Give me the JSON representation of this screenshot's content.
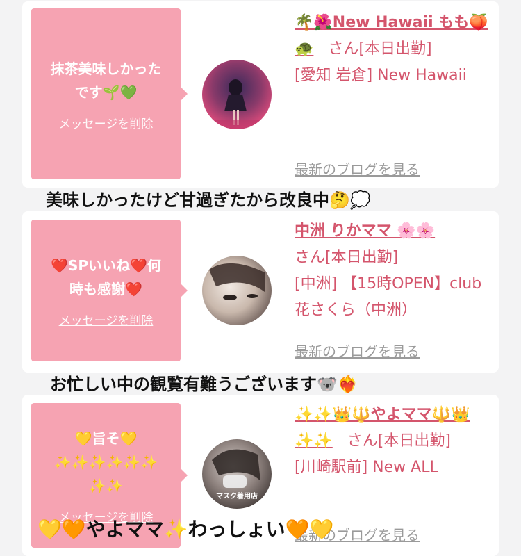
{
  "cards": [
    {
      "message": "抹茶美味しかった\nです🌱💚",
      "delete_label": "メッセージを削除",
      "shop_name": "🌴🌺New Hawaii もも🍑🐢",
      "honorific": "さん[本日出勤]",
      "location": "[愛知 岩倉] New Hawaii",
      "blog_label": "最新のブログを見る"
    },
    {
      "message": "❤️SPいいね❤️何\n時も感謝❤️",
      "delete_label": "メッセージを削除",
      "shop_name": "中洲 りかママ 🌸🌸",
      "honorific": "さん[本日出勤]",
      "location": "[中洲] 【15時OPEN】club 花さくら（中洲）",
      "blog_label": "最新のブログを見る"
    },
    {
      "message": "💛旨そ💛\n✨✨✨✨✨✨\n✨✨",
      "delete_label": "メッセージを削除",
      "shop_name": "✨✨👑🔱やよママ🔱👑✨✨",
      "honorific": "さん[本日出勤]",
      "location": "[川崎駅前] New ALL",
      "blog_label": "最新のブログを見る",
      "avatar_text": "マスク着用店"
    }
  ],
  "captions": [
    "美味しかったけど甘過ぎたから改良中🤔💭",
    "お忙しい中の観覧有難うございます🐨❤️‍🔥",
    "💛🧡やよママ✨わっしょい🧡💛"
  ],
  "colors": {
    "bubble": "#f6a3b2",
    "link": "#d4556c",
    "muted": "#9a9a9a"
  }
}
